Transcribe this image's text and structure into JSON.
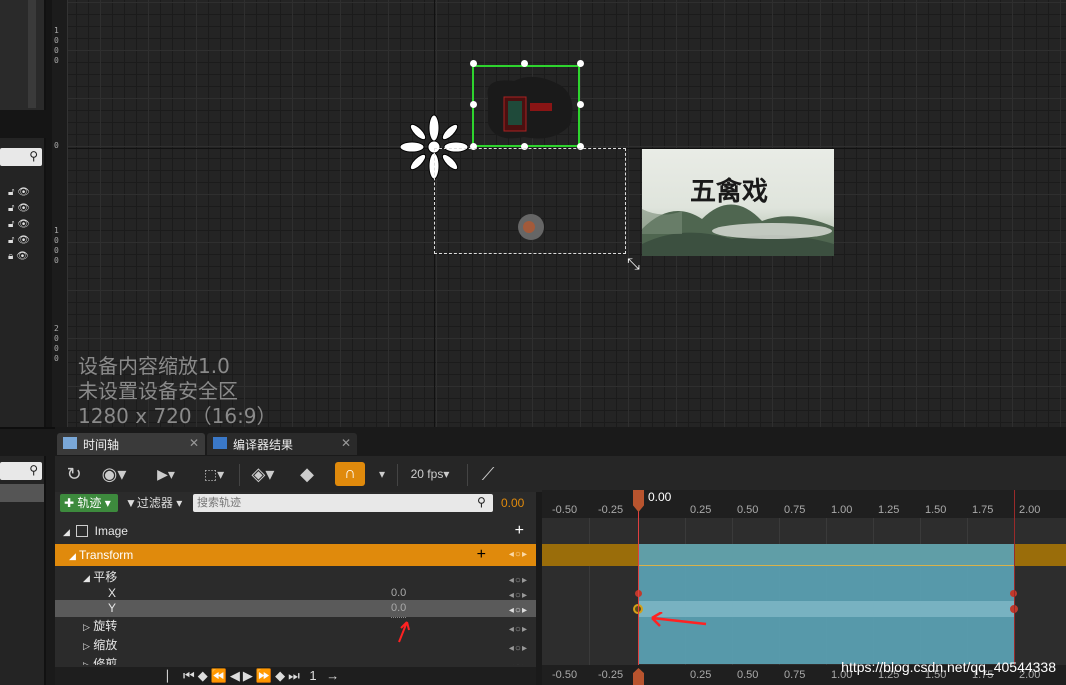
{
  "designer": {
    "overlay_line1": "设备内容缩放1.0",
    "overlay_line2": "未设置设备安全区",
    "overlay_line3": "1280 x 720（16:9）",
    "ruler_marks": [
      "1",
      "0",
      "0",
      "0",
      "0",
      "1",
      "0",
      "0",
      "0",
      "2",
      "0",
      "0",
      "0"
    ],
    "title_art_text": "五禽戏"
  },
  "tabs": [
    {
      "label": "时间轴",
      "close": "✕"
    },
    {
      "label": "编译器结果",
      "close": "✕"
    }
  ],
  "toolbar": {
    "fps_label": "20 fps"
  },
  "tracks": {
    "add_track_label": "轨迹",
    "filter_label": "过滤器",
    "search_placeholder": "搜索轨迹",
    "time_value": "0.00",
    "rows": [
      {
        "label": "Image"
      },
      {
        "label": "Transform"
      },
      {
        "label": "平移"
      },
      {
        "label": "X",
        "value": "0.0"
      },
      {
        "label": "Y",
        "value": "0.0"
      },
      {
        "label": "旋转"
      },
      {
        "label": "缩放"
      },
      {
        "label": "修剪"
      }
    ]
  },
  "timeline": {
    "current_time": "0.00",
    "ticks": [
      "-0.50",
      "-0.25",
      "0.25",
      "0.50",
      "0.75",
      "1.00",
      "1.25",
      "1.50",
      "1.75",
      "2.00"
    ],
    "bottom_ticks": [
      "-0.50",
      "-0.25",
      "0.25",
      "0.50",
      "0.75",
      "1.00",
      "1.25",
      "1.50",
      "1.75",
      "2.00"
    ]
  },
  "playback": {
    "frame_label": "1"
  },
  "watermark": "https://blog.csdn.net/qq_40544338",
  "colors": {
    "accent_orange": "#e08a0c",
    "selection_green": "#2ed42e",
    "track_teal": "#5ba3b5",
    "marker_red": "#c0392b"
  }
}
